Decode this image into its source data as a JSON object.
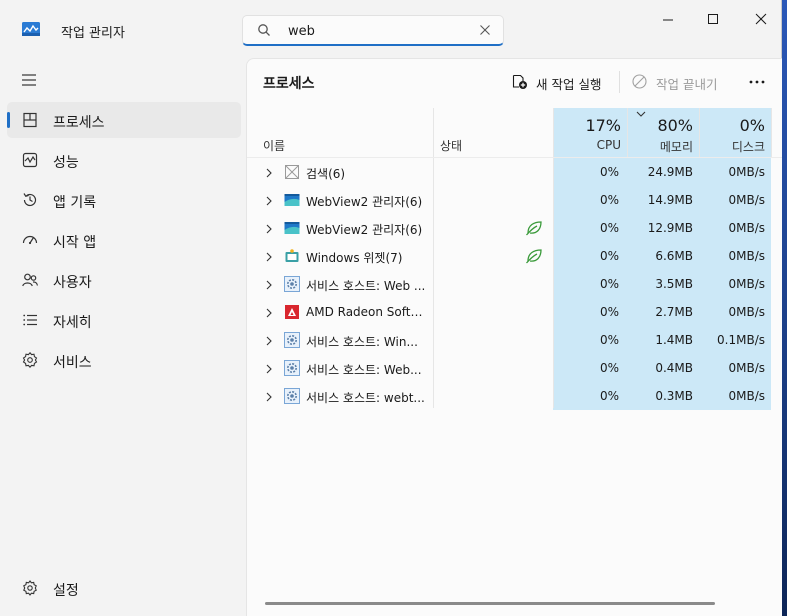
{
  "app": {
    "title": "작업 관리자"
  },
  "search": {
    "value": "web",
    "placeholder": ""
  },
  "sidebar": {
    "items": [
      {
        "label": "프로세스",
        "icon": "processes-icon",
        "active": true
      },
      {
        "label": "성능",
        "icon": "performance-icon"
      },
      {
        "label": "앱 기록",
        "icon": "app-history-icon"
      },
      {
        "label": "시작 앱",
        "icon": "startup-apps-icon"
      },
      {
        "label": "사용자",
        "icon": "users-icon"
      },
      {
        "label": "자세히",
        "icon": "details-icon"
      },
      {
        "label": "서비스",
        "icon": "services-icon"
      }
    ],
    "settings_label": "설정"
  },
  "toolbar": {
    "title": "프로세스",
    "new_task": "새 작업 실행",
    "end_task": "작업 끝내기"
  },
  "table": {
    "headers": {
      "name": "이름",
      "status": "상태",
      "cpu_pct": "17%",
      "cpu": "CPU",
      "mem_pct": "80%",
      "mem": "메모리",
      "disk_pct": "0%",
      "disk": "디스크"
    },
    "rows": [
      {
        "name": "검색(6)",
        "icon": "search-app-icon",
        "eco": false,
        "cpu": "0%",
        "mem": "24.9MB",
        "disk": "0MB/s"
      },
      {
        "name": "WebView2 관리자(6)",
        "icon": "webview-icon",
        "eco": false,
        "cpu": "0%",
        "mem": "14.9MB",
        "disk": "0MB/s"
      },
      {
        "name": "WebView2 관리자(6)",
        "icon": "webview-icon",
        "eco": true,
        "cpu": "0%",
        "mem": "12.9MB",
        "disk": "0MB/s"
      },
      {
        "name": "Windows 위젯(7)",
        "icon": "widgets-icon",
        "eco": true,
        "cpu": "0%",
        "mem": "6.6MB",
        "disk": "0MB/s"
      },
      {
        "name": "서비스 호스트: Web ...",
        "icon": "service-host-icon",
        "eco": false,
        "cpu": "0%",
        "mem": "3.5MB",
        "disk": "0MB/s"
      },
      {
        "name": "AMD Radeon Softw...",
        "icon": "amd-icon",
        "eco": false,
        "cpu": "0%",
        "mem": "2.7MB",
        "disk": "0MB/s"
      },
      {
        "name": "서비스 호스트: Win...",
        "icon": "service-host-icon",
        "eco": false,
        "cpu": "0%",
        "mem": "1.4MB",
        "disk": "0.1MB/s"
      },
      {
        "name": "서비스 호스트: Web...",
        "icon": "service-host-icon",
        "eco": false,
        "cpu": "0%",
        "mem": "0.4MB",
        "disk": "0MB/s"
      },
      {
        "name": "서비스 호스트: webt...",
        "icon": "service-host-icon",
        "eco": false,
        "cpu": "0%",
        "mem": "0.3MB",
        "disk": "0MB/s"
      }
    ]
  },
  "colors": {
    "accent": "#1f6fc6",
    "highlight": "#cce8f7",
    "eco": "#3a9a3a"
  }
}
